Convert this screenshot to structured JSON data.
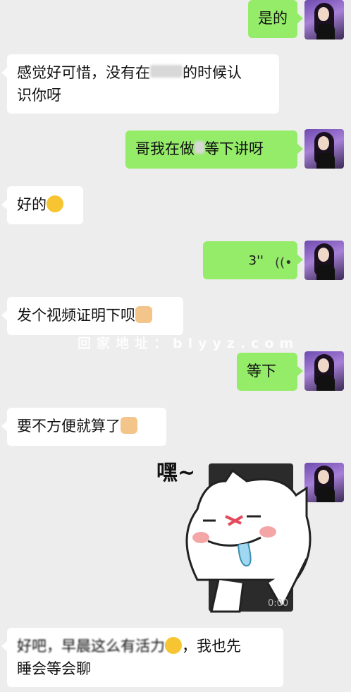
{
  "messages": [
    {
      "side": "right",
      "text": "是的"
    },
    {
      "side": "left",
      "text_line1": "感觉好可惜，没有在",
      "text_line1_tail": "的时候认",
      "text_line2": "识你呀"
    },
    {
      "side": "right",
      "text_a": "哥我在做",
      "text_b": "等下讲呀"
    },
    {
      "side": "left",
      "text": "好的"
    },
    {
      "side": "right",
      "voice_duration": "3''"
    },
    {
      "side": "left",
      "text": "发个视频证明下呗"
    },
    {
      "side": "right",
      "text": "等下"
    },
    {
      "side": "left",
      "text": "要不方便就算了"
    },
    {
      "side": "right",
      "sticker_caption": "嘿~",
      "sticker_time": "0:00"
    },
    {
      "side": "left",
      "text_line1_a": "好吧，",
      "text_line1_b": "早晨这么有活力",
      "text_line1_c": "，我也先",
      "text_line2": "睡会等会聊"
    }
  ],
  "watermark": "回家地址：blyyz.com",
  "colors": {
    "background": "#ededed",
    "sent_bubble": "#95ec69",
    "received_bubble": "#ffffff"
  },
  "icons": {
    "laugh": "laughing-emoji-icon",
    "dog": "doge-emoji-icon",
    "voice": "voice-wave-icon"
  }
}
